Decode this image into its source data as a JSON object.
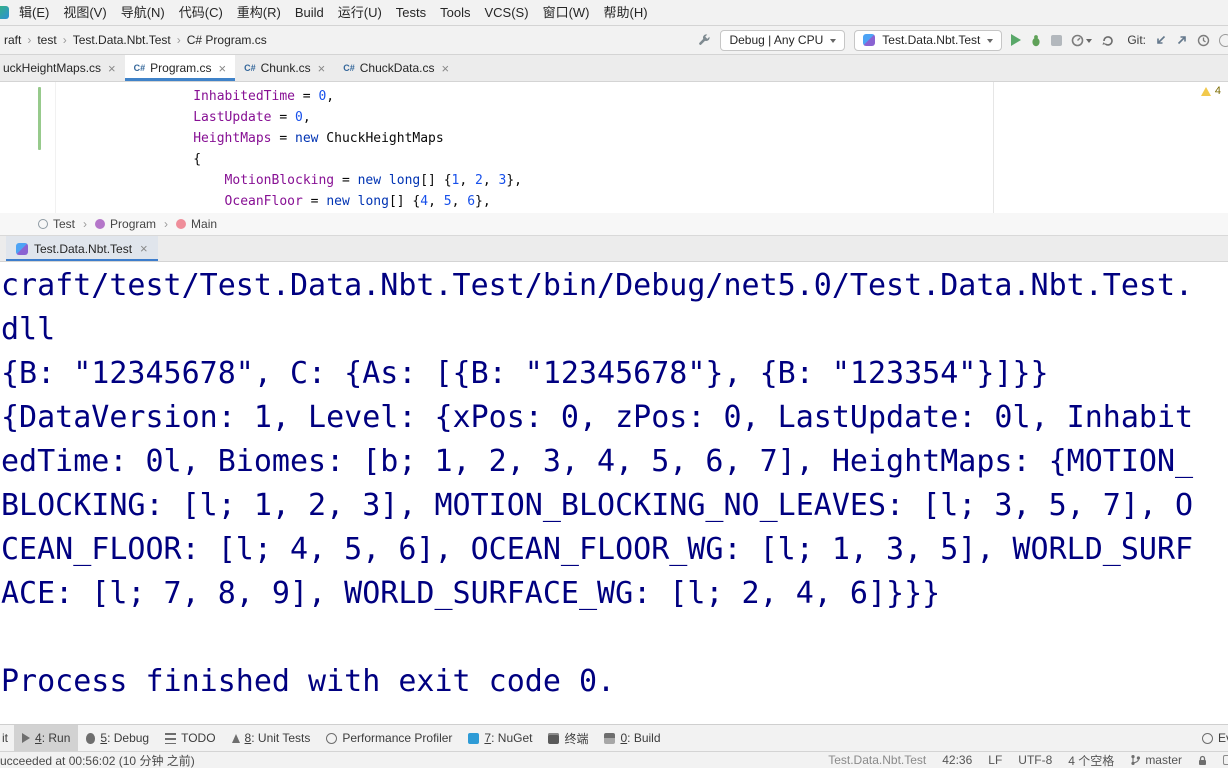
{
  "ui": {
    "close_glyph": "×",
    "breadcrumb_separator": "›",
    "warning_count": "4"
  },
  "menu_bar": {
    "items": [
      "辑(E)",
      "视图(V)",
      "导航(N)",
      "代码(C)",
      "重构(R)",
      "Build",
      "运行(U)",
      "Tests",
      "Tools",
      "VCS(S)",
      "窗口(W)",
      "帮助(H)"
    ]
  },
  "nav_bar": {
    "path": [
      "raft",
      "test",
      "Test.Data.Nbt.Test",
      "C# Program.cs"
    ],
    "build_config": "Debug | Any CPU",
    "run_config": "Test.Data.Nbt.Test",
    "git_label": "Git:"
  },
  "editor_tabs": [
    {
      "label": "uckHeightMaps.cs",
      "glyph": "",
      "icon": "",
      "active": false
    },
    {
      "label": "Program.cs",
      "glyph": "C#",
      "icon": "csharp-file-icon",
      "active": true
    },
    {
      "label": "Chunk.cs",
      "glyph": "C#",
      "icon": "csharp-file-icon",
      "active": false
    },
    {
      "label": "ChuckData.cs",
      "glyph": "C#",
      "icon": "csharp-file-icon",
      "active": false
    }
  ],
  "editor": {
    "code_lines": [
      [
        {
          "t": "                ",
          "c": "plain"
        },
        {
          "t": "InhabitedTime",
          "c": "field"
        },
        {
          "t": " = ",
          "c": "plain"
        },
        {
          "t": "0",
          "c": "num"
        },
        {
          "t": ",",
          "c": "plain"
        }
      ],
      [
        {
          "t": "                ",
          "c": "plain"
        },
        {
          "t": "LastUpdate",
          "c": "field"
        },
        {
          "t": " = ",
          "c": "plain"
        },
        {
          "t": "0",
          "c": "num"
        },
        {
          "t": ",",
          "c": "plain"
        }
      ],
      [
        {
          "t": "                ",
          "c": "plain"
        },
        {
          "t": "HeightMaps",
          "c": "field"
        },
        {
          "t": " = ",
          "c": "plain"
        },
        {
          "t": "new",
          "c": "kw"
        },
        {
          "t": " ChuckHeightMaps",
          "c": "plain"
        }
      ],
      [
        {
          "t": "                {",
          "c": "plain"
        }
      ],
      [
        {
          "t": "                    ",
          "c": "plain"
        },
        {
          "t": "MotionBlocking",
          "c": "field"
        },
        {
          "t": " = ",
          "c": "plain"
        },
        {
          "t": "new",
          "c": "kw"
        },
        {
          "t": " ",
          "c": "plain"
        },
        {
          "t": "long",
          "c": "kw"
        },
        {
          "t": "[] {",
          "c": "plain"
        },
        {
          "t": "1",
          "c": "num"
        },
        {
          "t": ", ",
          "c": "plain"
        },
        {
          "t": "2",
          "c": "num"
        },
        {
          "t": ", ",
          "c": "plain"
        },
        {
          "t": "3",
          "c": "num"
        },
        {
          "t": "},",
          "c": "plain"
        }
      ],
      [
        {
          "t": "                    ",
          "c": "plain"
        },
        {
          "t": "OceanFloor",
          "c": "field"
        },
        {
          "t": " = ",
          "c": "plain"
        },
        {
          "t": "new",
          "c": "kw"
        },
        {
          "t": " ",
          "c": "plain"
        },
        {
          "t": "long",
          "c": "kw"
        },
        {
          "t": "[] {",
          "c": "plain"
        },
        {
          "t": "4",
          "c": "num"
        },
        {
          "t": ", ",
          "c": "plain"
        },
        {
          "t": "5",
          "c": "num"
        },
        {
          "t": ", ",
          "c": "plain"
        },
        {
          "t": "6",
          "c": "num"
        },
        {
          "t": "},",
          "c": "plain"
        }
      ]
    ]
  },
  "breadcrumbs": [
    {
      "label": "Test",
      "icon": "namespace-icon"
    },
    {
      "label": "Program",
      "icon": "class-icon"
    },
    {
      "label": "Main",
      "icon": "method-icon"
    }
  ],
  "run_panel": {
    "tab_label": "Test.Data.Nbt.Test",
    "console_lines": [
      "craft/test/Test.Data.Nbt.Test/bin/Debug/net5.0/Test.Data.Nbt.Test.",
      "dll",
      "{B: \"12345678\", C: {As: [{B: \"12345678\"}, {B: \"123354\"}]}}",
      "{DataVersion: 1, Level: {xPos: 0, zPos: 0, LastUpdate: 0l, Inhabit",
      "edTime: 0l, Biomes: [b; 1, 2, 3, 4, 5, 6, 7], HeightMaps: {MOTION_",
      "BLOCKING: [l; 1, 2, 3], MOTION_BLOCKING_NO_LEAVES: [l; 3, 5, 7], O",
      "CEAN_FLOOR: [l; 4, 5, 6], OCEAN_FLOOR_WG: [l; 1, 3, 5], WORLD_SURF",
      "ACE: [l; 7, 8, 9], WORLD_SURFACE_WG: [l; 2, 4, 6]}}}",
      "",
      "Process finished with exit code 0."
    ]
  },
  "tool_windows": {
    "left_cut_label": "it",
    "event_log_label": "Ev",
    "items": [
      {
        "name": "run",
        "label": "4: Run",
        "icon": "run-icon",
        "active": true
      },
      {
        "name": "debug",
        "label": "5: Debug",
        "icon": "debug-icon",
        "active": false
      },
      {
        "name": "todo",
        "label": "TODO",
        "icon": "todo-icon",
        "active": false
      },
      {
        "name": "unit-tests",
        "label": "8: Unit Tests",
        "icon": "unit-tests-icon",
        "active": false
      },
      {
        "name": "performance-profiler",
        "label": "Performance Profiler",
        "icon": "profiler-icon",
        "active": false
      },
      {
        "name": "nuget",
        "label": "7: NuGet",
        "icon": "nuget-icon",
        "active": false
      },
      {
        "name": "terminal",
        "label": "终端",
        "icon": "terminal-icon",
        "active": false
      },
      {
        "name": "build",
        "label": "0: Build",
        "icon": "build-icon",
        "active": false
      }
    ]
  },
  "status_bar": {
    "message": "ucceeded at 00:56:02 (10 分钟 之前)",
    "run_config": "Test.Data.Nbt.Test",
    "caret": "42:36",
    "line_ending": "LF",
    "encoding": "UTF-8",
    "indent": "4 个空格",
    "branch": "master"
  }
}
